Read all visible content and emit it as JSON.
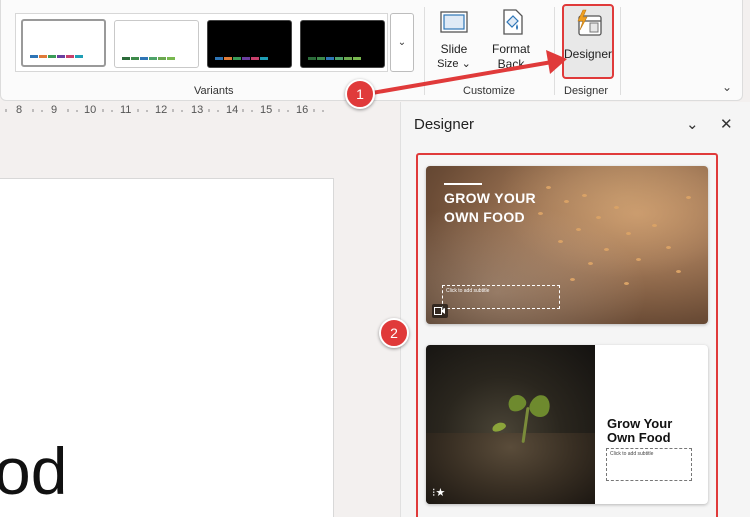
{
  "ribbon": {
    "variants": {
      "label": "Variants",
      "more_glyph": "⌄",
      "items": [
        {
          "style": "light",
          "selected": true,
          "swatches": [
            "#2e75b6",
            "#e07b39",
            "#3a9b58",
            "#6a3fa0",
            "#c8406b",
            "#1f9eb5"
          ]
        },
        {
          "style": "light",
          "selected": false,
          "swatches": [
            "#2b6b3a",
            "#3d8a4a",
            "#2e75b6",
            "#4ea36a",
            "#6ba84f",
            "#78b84f"
          ]
        },
        {
          "style": "dark",
          "selected": false,
          "swatches": [
            "#2e75b6",
            "#e07b39",
            "#3a9b58",
            "#6a3fa0",
            "#c8406b",
            "#1f9eb5"
          ]
        },
        {
          "style": "dark",
          "selected": false,
          "swatches": [
            "#2b6b3a",
            "#3d8a4a",
            "#2e75b6",
            "#4ea36a",
            "#6ba84f",
            "#78b84f"
          ]
        }
      ]
    },
    "customize": {
      "label": "Customize",
      "slide_size": {
        "line1": "Slide",
        "line2": "Size ⌄"
      },
      "format_background": {
        "line1": "Format",
        "line2": "Back"
      }
    },
    "designer_group": {
      "label": "Designer",
      "button_label": "Designer"
    },
    "collapse_glyph": "⌄"
  },
  "ruler": {
    "ticks": [
      "8",
      "9",
      "10",
      "11",
      "12",
      "13",
      "14",
      "15",
      "16"
    ]
  },
  "slide": {
    "visible_text": "od"
  },
  "designer_pane": {
    "title": "Designer",
    "collapse_glyph": "⌄",
    "close_glyph": "✕",
    "cards": [
      {
        "title_line1": "GROW YOUR",
        "title_line2": "OWN FOOD",
        "subtitle_placeholder": "Click to add subtitle",
        "badge_icon": "video-icon"
      },
      {
        "title_line1": "Grow Your",
        "title_line2": "Own Food",
        "subtitle_placeholder": "Click to add subtitle",
        "badge_icon": "animation-star-icon"
      }
    ]
  },
  "callouts": {
    "step1": "1",
    "step2": "2"
  },
  "colors": {
    "callout_red": "#e03a3a"
  }
}
